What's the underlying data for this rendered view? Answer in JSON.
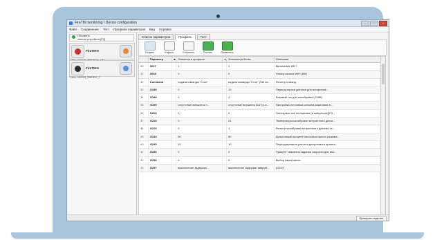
{
  "window": {
    "title": "FireTM monitoring / Device configuration"
  },
  "menu": [
    "Файл",
    "Соединение",
    "Тест",
    "Профили параметров",
    "Вид",
    "Справка"
  ],
  "sidebar": {
    "refresh_label": "Обновить\nсписок устройств [F5]",
    "devices": [
      {
        "name": "FireTM-6",
        "serial": "Сеть: 182220_ЯМПЕОХ_187"
      },
      {
        "name": "FireTM-5",
        "serial": "Сеть: 182226_ЯМПЕО_7"
      }
    ]
  },
  "tabs": [
    "Список параметров",
    "Профиль",
    "Тест"
  ],
  "active_tab": 1,
  "toolbar": [
    "Создать",
    "Открыть",
    "Сохранить",
    "Считать",
    "Применить"
  ],
  "table": {
    "headers": [
      "",
      "Параметр",
      "",
      "Значения в профиле",
      "",
      "Значения в блоке",
      "Описание"
    ],
    "rows": [
      [
        "30",
        "0007",
        "1",
        "1",
        "Включение WiFi"
      ],
      [
        "31",
        "0008",
        "0",
        "0",
        "Номер канала WiFi (ВИ)"
      ],
      [
        "32",
        "Command",
        "подача команды \"Стоп\"",
        "подача команды \"Стоп\" (Set cd...",
        "Регистр команд"
      ],
      [
        "33",
        "G185",
        "0",
        "10",
        "Период опроса датчика для алгоритма..."
      ],
      [
        "34",
        "G188",
        "0",
        "4",
        "Базовый ток для калибровки (G188)"
      ],
      [
        "35",
        "G199",
        "отсутствие внешнего п...",
        "отсутствие внешнего 4ШТ(1-а...",
        "Настройка источника сигнала зажигания в..."
      ],
      [
        "36",
        "G208",
        "0",
        "0",
        "Гистерезис зон положения (в импульсах)[P3..."
      ],
      [
        "37",
        "G228",
        "0",
        "25",
        "Температура калибровки встроенного датчи..."
      ],
      [
        "38",
        "G229",
        "0",
        "1",
        "Регистр калибровки встроенного датчика те..."
      ],
      [
        "39",
        "G244",
        "80",
        "80",
        "Допустимый процент износа моторного режима..."
      ],
      [
        "40",
        "G245",
        "10",
        "10",
        "Период времени расчета допустимого времен..."
      ],
      [
        "41",
        "G250",
        "0",
        "0",
        "Процент снижения задания скорости для вно..."
      ],
      [
        "42",
        "G256",
        "0",
        "0",
        "Выбор языка меню"
      ],
      [
        "43",
        "G257",
        "выключение задержки...",
        "выключение задержки аварий...",
        "(G257)"
      ]
    ]
  },
  "status": {
    "button": "Проверить изделие"
  }
}
